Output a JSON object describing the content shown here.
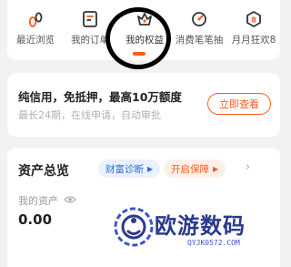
{
  "nav": {
    "items": [
      {
        "label": "最近浏览",
        "icon": "footprint-icon"
      },
      {
        "label": "我的订单",
        "icon": "order-icon"
      },
      {
        "label": "我的权益",
        "icon": "rights-icon"
      },
      {
        "label": "消费笔笔抽",
        "icon": "lottery-icon"
      },
      {
        "label": "月月狂欢8",
        "icon": "carnival-icon"
      }
    ],
    "active_index": 2
  },
  "loan": {
    "title": "纯信用，免抵押，最高10万额度",
    "subtitle": "最长24期，在线申请，自动审批",
    "button": "立即查看"
  },
  "assets": {
    "title": "资产总览",
    "pill_wealth": "财富诊断",
    "pill_protect": "开启保障",
    "my_asset_label": "我的资产",
    "value": "0.00"
  },
  "watermark": {
    "text": "欧游数码",
    "sub": "QYJK0572.COM"
  },
  "colors": {
    "accent": "#ff5a1f",
    "blue": "#2f6bd8",
    "brand_dark": "#2b3a8c"
  }
}
